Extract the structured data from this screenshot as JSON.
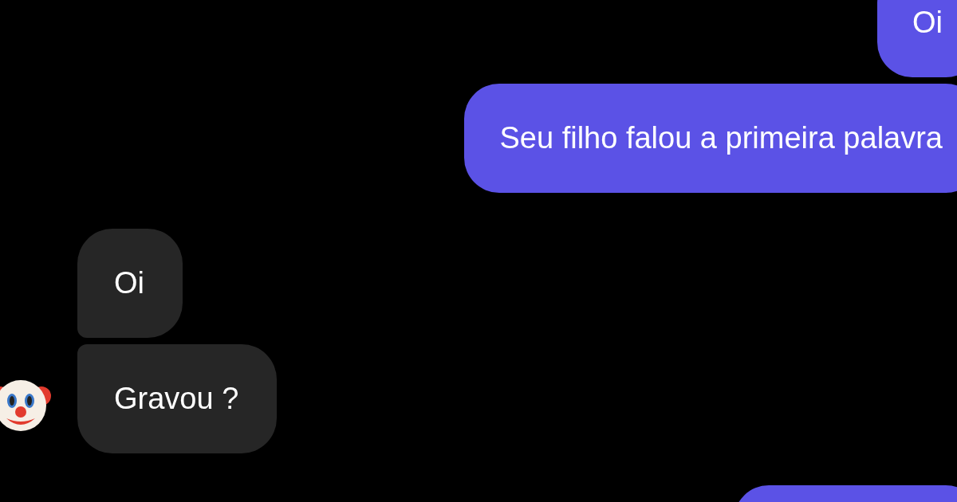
{
  "groups": [
    {
      "kind": "outgoing",
      "messages": [
        "Oi",
        "Seu filho falou a primeira palavra"
      ]
    },
    {
      "kind": "incoming",
      "avatar": true,
      "messages": [
        "Oi",
        "Gravou ?"
      ]
    },
    {
      "kind": "outgoing",
      "partial": true
    }
  ]
}
